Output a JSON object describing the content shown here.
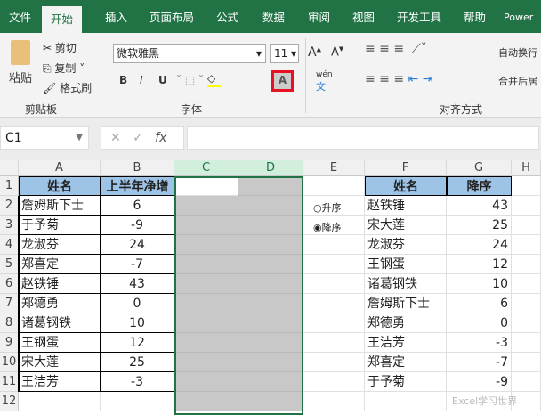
{
  "ribbon_tabs": [
    "文件",
    "开始",
    "插入",
    "页面布局",
    "公式",
    "数据",
    "审阅",
    "视图",
    "开发工具",
    "帮助",
    "Power"
  ],
  "active_tab": "开始",
  "clipboard": {
    "paste": "粘贴",
    "cut": "剪切",
    "copy": "复制",
    "format_painter": "格式刷",
    "group": "剪贴板"
  },
  "font": {
    "name": "微软雅黑",
    "size": "11",
    "bold": "B",
    "italic": "I",
    "underline": "U",
    "font_color": "A",
    "phonetic": "wén",
    "group": "字体"
  },
  "alignment": {
    "wrap": "自动换行",
    "merge": "合并后居",
    "group": "对齐方式"
  },
  "formula_bar": {
    "name_box": "C1",
    "fx": "fx",
    "value": ""
  },
  "columns": [
    "A",
    "B",
    "C",
    "D",
    "E",
    "F",
    "G",
    "H"
  ],
  "rows": [
    "1",
    "2",
    "3",
    "4",
    "5",
    "6",
    "7",
    "8",
    "9",
    "10",
    "11",
    "12"
  ],
  "table1": {
    "headers": [
      "姓名",
      "上半年净增"
    ],
    "rows": [
      [
        "詹姆斯下士",
        "6"
      ],
      [
        "于予菊",
        "-9"
      ],
      [
        "龙淑芬",
        "24"
      ],
      [
        "郑喜定",
        "-7"
      ],
      [
        "赵铁锤",
        "43"
      ],
      [
        "郑德勇",
        "0"
      ],
      [
        "诸葛钢铁",
        "10"
      ],
      [
        "王钢蛋",
        "12"
      ],
      [
        "宋大莲",
        "25"
      ],
      [
        "王洁芳",
        "-3"
      ]
    ]
  },
  "sort_options": [
    {
      "label": "升序",
      "selected": false
    },
    {
      "label": "降序",
      "selected": true
    }
  ],
  "table2": {
    "headers": [
      "姓名",
      "降序"
    ],
    "rows": [
      [
        "赵铁锤",
        "43"
      ],
      [
        "宋大莲",
        "25"
      ],
      [
        "龙淑芬",
        "24"
      ],
      [
        "王钢蛋",
        "12"
      ],
      [
        "诸葛钢铁",
        "10"
      ],
      [
        "詹姆斯下士",
        "6"
      ],
      [
        "郑德勇",
        "0"
      ],
      [
        "王洁芳",
        "-3"
      ],
      [
        "郑喜定",
        "-7"
      ],
      [
        "于予菊",
        "-9"
      ]
    ]
  },
  "watermark": "Excel学习世界",
  "colors": {
    "brand": "#217346",
    "header_fill": "#9dc3e6",
    "highlight": "#e81123"
  }
}
